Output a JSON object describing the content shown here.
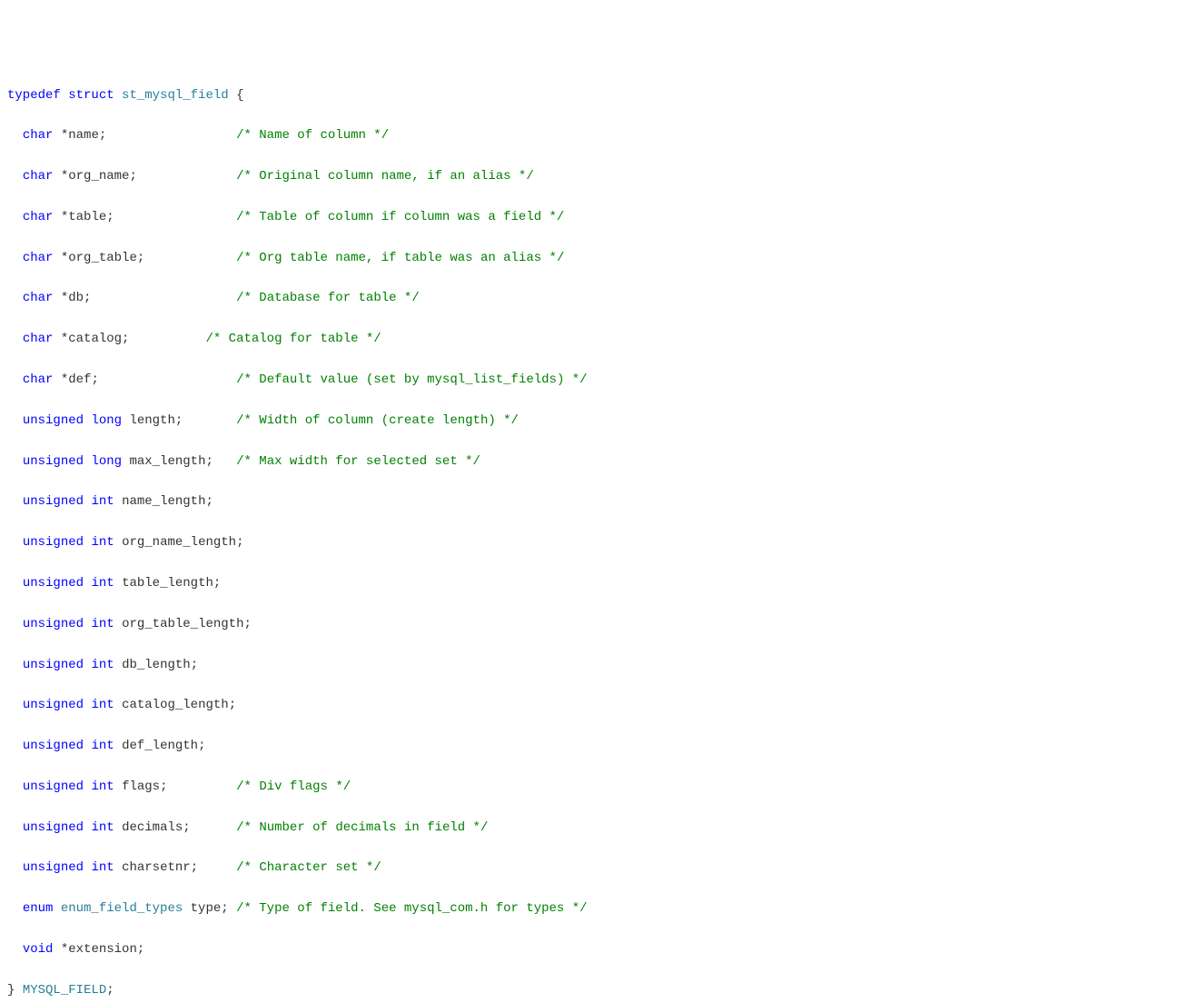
{
  "code": {
    "l0": {
      "kw1": "typedef",
      "kw2": "struct",
      "type": "st_mysql_field",
      "brace": "{"
    },
    "l1": {
      "kw": "char",
      "ptr": "*",
      "id": "name",
      "semi": ";",
      "cm": "/* Name of column */"
    },
    "l2": {
      "kw": "char",
      "ptr": "*",
      "id": "org_name",
      "semi": ";",
      "cm": "/* Original column name, if an alias */"
    },
    "l3": {
      "kw": "char",
      "ptr": "*",
      "id": "table",
      "semi": ";",
      "cm": "/* Table of column if column was a field */"
    },
    "l4": {
      "kw": "char",
      "ptr": "*",
      "id": "org_table",
      "semi": ";",
      "cm": "/* Org table name, if table was an alias */"
    },
    "l5": {
      "kw": "char",
      "ptr": "*",
      "id": "db",
      "semi": ";",
      "cm": "/* Database for table */"
    },
    "l6": {
      "kw": "char",
      "ptr": "*",
      "id": "catalog",
      "semi": ";",
      "cm": "/* Catalog for table */"
    },
    "l7": {
      "kw": "char",
      "ptr": "*",
      "id": "def",
      "semi": ";",
      "cm": "/* Default value (set by mysql_list_fields) */"
    },
    "l8": {
      "kw1": "unsigned",
      "kw2": "long",
      "id": "length",
      "semi": ";",
      "cm": "/* Width of column (create length) */"
    },
    "l9": {
      "kw1": "unsigned",
      "kw2": "long",
      "id": "max_length",
      "semi": ";",
      "cm": "/* Max width for selected set */"
    },
    "l10": {
      "kw1": "unsigned",
      "kw2": "int",
      "id": "name_length",
      "semi": ";"
    },
    "l11": {
      "kw1": "unsigned",
      "kw2": "int",
      "id": "org_name_length",
      "semi": ";"
    },
    "l12": {
      "kw1": "unsigned",
      "kw2": "int",
      "id": "table_length",
      "semi": ";"
    },
    "l13": {
      "kw1": "unsigned",
      "kw2": "int",
      "id": "org_table_length",
      "semi": ";"
    },
    "l14": {
      "kw1": "unsigned",
      "kw2": "int",
      "id": "db_length",
      "semi": ";"
    },
    "l15": {
      "kw1": "unsigned",
      "kw2": "int",
      "id": "catalog_length",
      "semi": ";"
    },
    "l16": {
      "kw1": "unsigned",
      "kw2": "int",
      "id": "def_length",
      "semi": ";"
    },
    "l17": {
      "kw1": "unsigned",
      "kw2": "int",
      "id": "flags",
      "semi": ";",
      "cm": "/* Div flags */"
    },
    "l18": {
      "kw1": "unsigned",
      "kw2": "int",
      "id": "decimals",
      "semi": ";",
      "cm": "/* Number of decimals in field */"
    },
    "l19": {
      "kw1": "unsigned",
      "kw2": "int",
      "id": "charsetnr",
      "semi": ";",
      "cm": "/* Character set */"
    },
    "l20": {
      "kw": "enum",
      "type": "enum_field_types",
      "id": "type",
      "semi": ";",
      "cm": "/* Type of field. See mysql_com.h for types */"
    },
    "l21": {
      "kw": "void",
      "ptr": "*",
      "id": "extension",
      "semi": ";"
    },
    "l22": {
      "brace": "}",
      "type": "MYSQL_FIELD",
      "semi": ";"
    }
  }
}
